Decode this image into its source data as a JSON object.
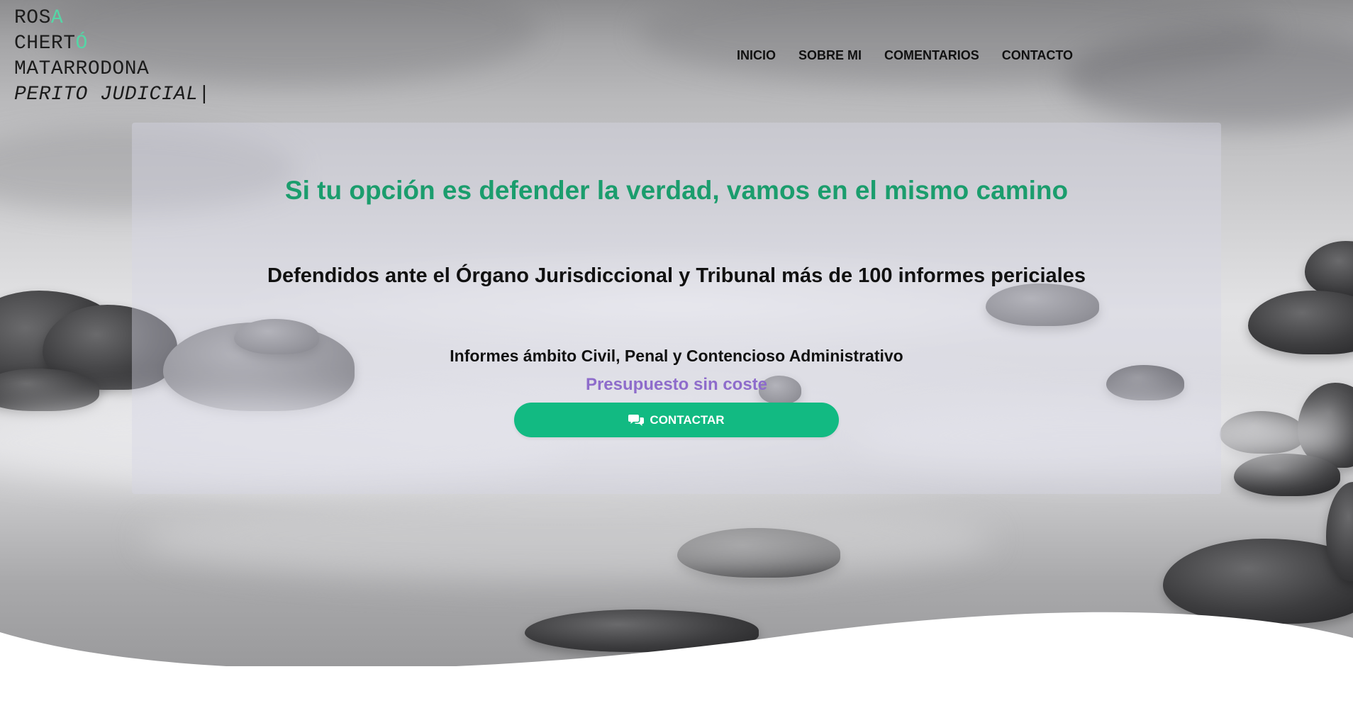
{
  "brand": {
    "line1_main": "ROS",
    "line1_accent": "A",
    "line2_main": "CHERT",
    "line2_accent": "Ó",
    "line3": "MATARRODONA",
    "tagline": "PERITO JUDICIAL",
    "cursor": "|",
    "accent_color": "#55d6a6"
  },
  "nav": {
    "items": [
      {
        "label": "INICIO"
      },
      {
        "label": "SOBRE MI"
      },
      {
        "label": "COMENTARIOS"
      },
      {
        "label": "CONTACTO"
      }
    ]
  },
  "hero": {
    "headline": "Si tu opción es defender la verdad, vamos en el mismo camino",
    "subheadline": "Defendidos ante el Órgano Jurisdiccional y Tribunal más de 100 informes periciales",
    "scope": "Informes ámbito Civil, Penal y Contencioso Administrativo",
    "budget": "Presupuesto sin coste",
    "cta_label": "CONTACTAR",
    "cta_icon": "chat-bubbles-icon"
  },
  "colors": {
    "headline": "#1b9d6d",
    "budget": "#8e6ccb",
    "cta_background": "#12ba82",
    "text": "#111111"
  }
}
